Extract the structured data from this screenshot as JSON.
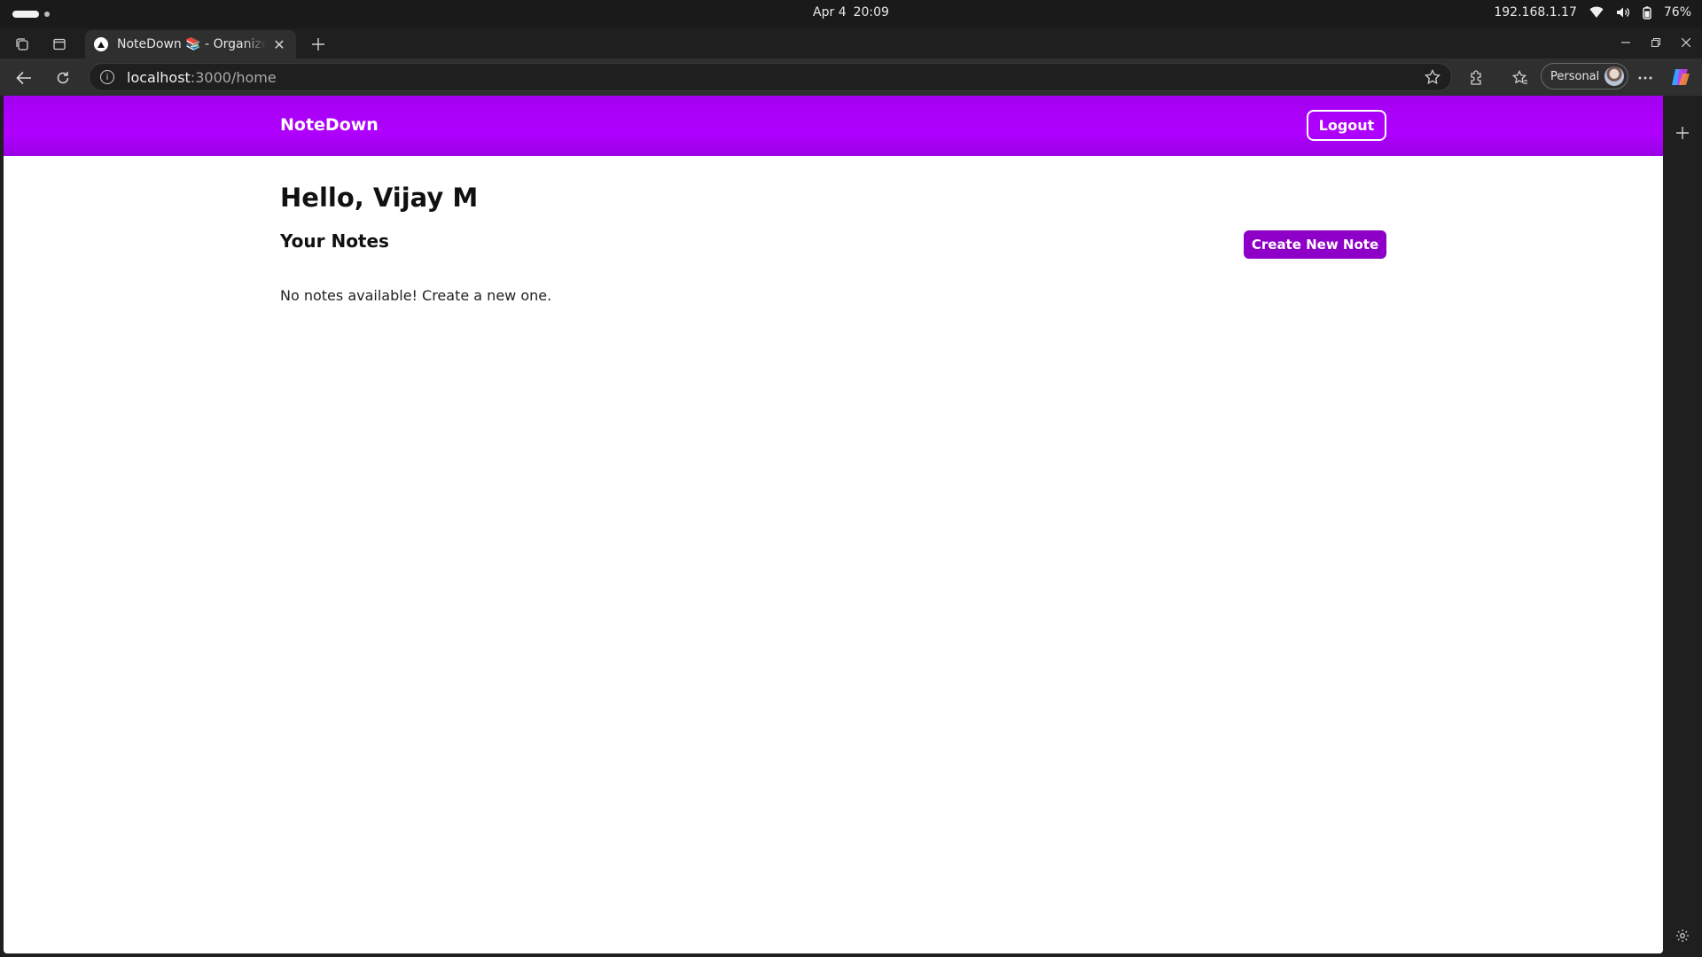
{
  "os": {
    "date": "Apr 4",
    "time": "20:09",
    "ip": "192.168.1.17",
    "battery": "76%"
  },
  "browser": {
    "tab_title": "NoteDown 📚 - Organize Your Notes",
    "url_host": "localhost",
    "url_path": ":3000/home",
    "profile_label": "Personal"
  },
  "app": {
    "brand": "NoteDown",
    "logout_label": "Logout",
    "greeting": "Hello, Vijay M",
    "notes_heading": "Your Notes",
    "create_label": "Create New Note",
    "empty_message": "No notes available! Create a new one.",
    "accent_color": "#b000ff",
    "button_color": "#8e00c7"
  }
}
